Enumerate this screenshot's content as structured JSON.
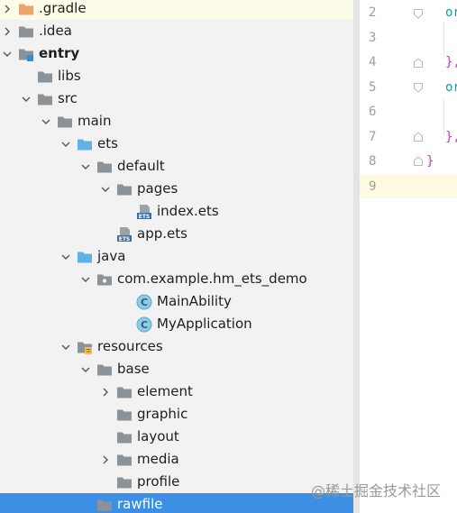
{
  "project_tree": {
    "items": [
      {
        "label": ".gradle",
        "expand": "collapsed",
        "icon": "orange-folder-icon"
      },
      {
        "label": ".idea",
        "expand": "collapsed",
        "icon": "folder-icon"
      },
      {
        "label": "entry",
        "expand": "expanded",
        "icon": "module-folder-icon",
        "bold": true
      },
      {
        "label": "libs",
        "expand": "none",
        "icon": "folder-icon"
      },
      {
        "label": "src",
        "expand": "expanded",
        "icon": "folder-icon"
      },
      {
        "label": "main",
        "expand": "expanded",
        "icon": "folder-icon"
      },
      {
        "label": "ets",
        "expand": "expanded",
        "icon": "source-folder-icon"
      },
      {
        "label": "default",
        "expand": "expanded",
        "icon": "folder-icon"
      },
      {
        "label": "pages",
        "expand": "expanded",
        "icon": "folder-icon"
      },
      {
        "label": "index.ets",
        "expand": "none",
        "icon": "ets-file-icon"
      },
      {
        "label": "app.ets",
        "expand": "none",
        "icon": "ets-file-icon"
      },
      {
        "label": "java",
        "expand": "expanded",
        "icon": "source-folder-icon"
      },
      {
        "label": "com.example.hm_ets_demo",
        "expand": "expanded",
        "icon": "package-icon"
      },
      {
        "label": "MainAbility",
        "expand": "none",
        "icon": "class-icon"
      },
      {
        "label": "MyApplication",
        "expand": "none",
        "icon": "class-icon"
      },
      {
        "label": "resources",
        "expand": "expanded",
        "icon": "resources-folder-icon"
      },
      {
        "label": "base",
        "expand": "expanded",
        "icon": "folder-icon"
      },
      {
        "label": "element",
        "expand": "collapsed",
        "icon": "folder-icon"
      },
      {
        "label": "graphic",
        "expand": "none",
        "icon": "folder-icon"
      },
      {
        "label": "layout",
        "expand": "none",
        "icon": "folder-icon"
      },
      {
        "label": "media",
        "expand": "collapsed",
        "icon": "folder-icon"
      },
      {
        "label": "profile",
        "expand": "none",
        "icon": "folder-icon"
      },
      {
        "label": "rawfile",
        "expand": "none",
        "icon": "folder-icon",
        "selected": true
      }
    ]
  },
  "ets_badge": "ETS",
  "class_badge": "C",
  "editor": {
    "line_numbers": [
      "2",
      "3",
      "4",
      "5",
      "6",
      "7",
      "8",
      "9"
    ],
    "code_fragments": [
      {
        "text": "or",
        "color": "#0f9ea8"
      },
      {
        "text": "},",
        "color": "#c43fb3"
      },
      {
        "text": "or",
        "color": "#0f9ea8"
      },
      {
        "text": "},",
        "color": "#c43fb3"
      },
      {
        "text": "}",
        "color": "#c43fb3"
      }
    ]
  },
  "watermark": "@稀土掘金技术社区",
  "colors": {
    "selection": "#3d8fe6",
    "tree_background": "#f2f2f2",
    "folder_gray": "#8c9398",
    "folder_blue": "#62b1e6",
    "folder_orange": "#f0a368"
  }
}
